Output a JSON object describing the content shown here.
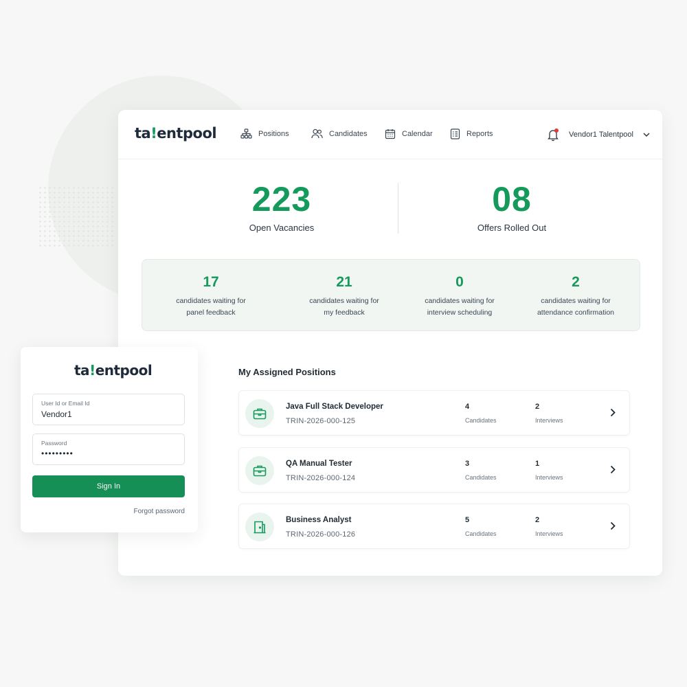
{
  "brand": {
    "prefix": "ta",
    "accent": "!",
    "suffix": "entpool",
    "accent_color": "#159a5b",
    "primary_color": "#158f56"
  },
  "nav": [
    {
      "label": "Positions",
      "icon": "sitemap-icon"
    },
    {
      "label": "Candidates",
      "icon": "users-icon"
    },
    {
      "label": "Calendar",
      "icon": "calendar-icon"
    },
    {
      "label": "Reports",
      "icon": "report-icon"
    }
  ],
  "user": {
    "name": "Vendor1 Talentpool",
    "notification_icon": "bell-icon",
    "has_notification": true
  },
  "stats": {
    "open_vacancies": {
      "value": "223",
      "label": "Open Vacancies"
    },
    "offers": {
      "value": "08",
      "label": "Offers Rolled Out"
    }
  },
  "waiting": [
    {
      "value": "17",
      "line1": "candidates waiting for",
      "line2": "panel feedback"
    },
    {
      "value": "21",
      "line1": "candidates waiting for",
      "line2": "my feedback"
    },
    {
      "value": "0",
      "line1": "candidates waiting for",
      "line2": "interview scheduling"
    },
    {
      "value": "2",
      "line1": "candidates waiting for",
      "line2": "attendance confirmation"
    }
  ],
  "positions": {
    "title": "My Assigned Positions",
    "items": [
      {
        "title": "Java Full Stack Developer",
        "code": "TRIN-2026-000-125",
        "candidates": "4",
        "candidates_label": "Candidates",
        "interviews": "2",
        "interviews_label": "Interviews",
        "icon": "briefcase-icon"
      },
      {
        "title": "QA Manual Tester",
        "code": "TRIN-2026-000-124",
        "candidates": "3",
        "candidates_label": "Candidates",
        "interviews": "1",
        "interviews_label": "Interviews",
        "icon": "briefcase-icon"
      },
      {
        "title": "Business Analyst",
        "code": "TRIN-2026-000-126",
        "candidates": "5",
        "candidates_label": "Candidates",
        "interviews": "2",
        "interviews_label": "Interviews",
        "icon": "door-icon"
      }
    ]
  },
  "login": {
    "user_label": "User Id or Email Id",
    "user_value": "Vendor1",
    "password_label": "Password",
    "password_value": "•••••••••",
    "signin_label": "Sign In",
    "forgot_label": "Forgot password"
  }
}
